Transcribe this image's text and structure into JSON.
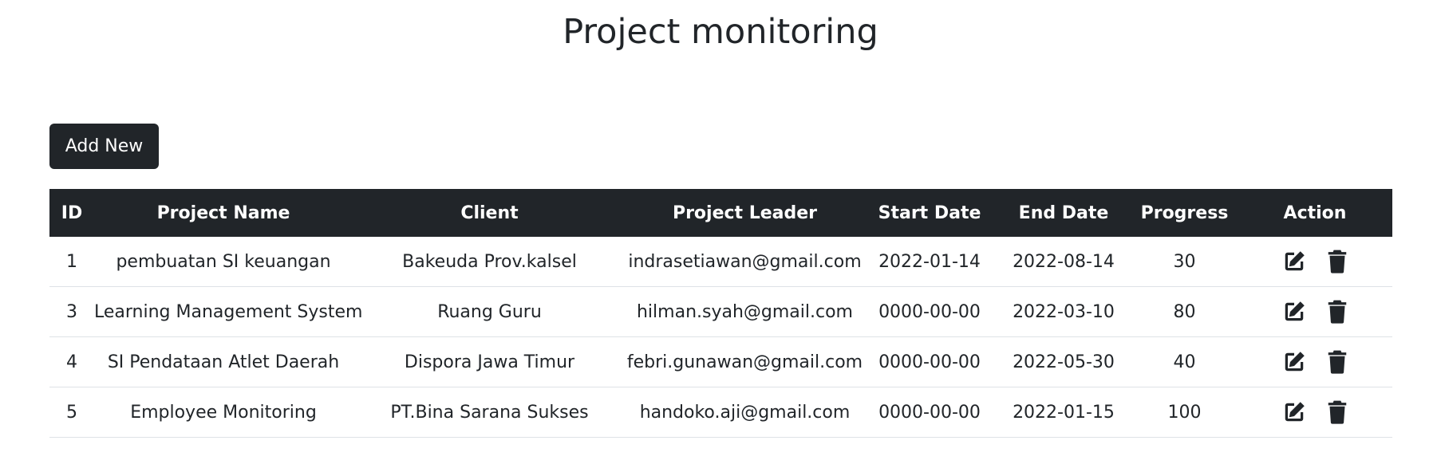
{
  "page": {
    "title": "Project monitoring"
  },
  "toolbar": {
    "add_label": "Add New"
  },
  "table": {
    "headers": {
      "id": "ID",
      "name": "Project Name",
      "client": "Client",
      "leader": "Project Leader",
      "start": "Start Date",
      "end": "End Date",
      "progress": "Progress",
      "action": "Action"
    },
    "rows": [
      {
        "id": "1",
        "name": "pembuatan SI keuangan",
        "client": "Bakeuda Prov.kalsel",
        "leader": "indrasetiawan@gmail.com",
        "start": "2022-01-14",
        "end": "2022-08-14",
        "progress": "30"
      },
      {
        "id": "3",
        "name": "Learning Management System",
        "client": "Ruang Guru",
        "leader": "hilman.syah@gmail.com",
        "start": "0000-00-00",
        "end": "2022-03-10",
        "progress": "80"
      },
      {
        "id": "4",
        "name": "SI Pendataan Atlet Daerah",
        "client": "Dispora Jawa Timur",
        "leader": "febri.gunawan@gmail.com",
        "start": "0000-00-00",
        "end": "2022-05-30",
        "progress": "40"
      },
      {
        "id": "5",
        "name": "Employee Monitoring",
        "client": "PT.Bina Sarana Sukses",
        "leader": "handoko.aji@gmail.com",
        "start": "0000-00-00",
        "end": "2022-01-15",
        "progress": "100"
      }
    ],
    "row_icons": [
      "edit-icon",
      "trash-icon"
    ]
  },
  "colors": {
    "dark": "#212529",
    "border": "#dee2e6",
    "background": "#ffffff"
  }
}
